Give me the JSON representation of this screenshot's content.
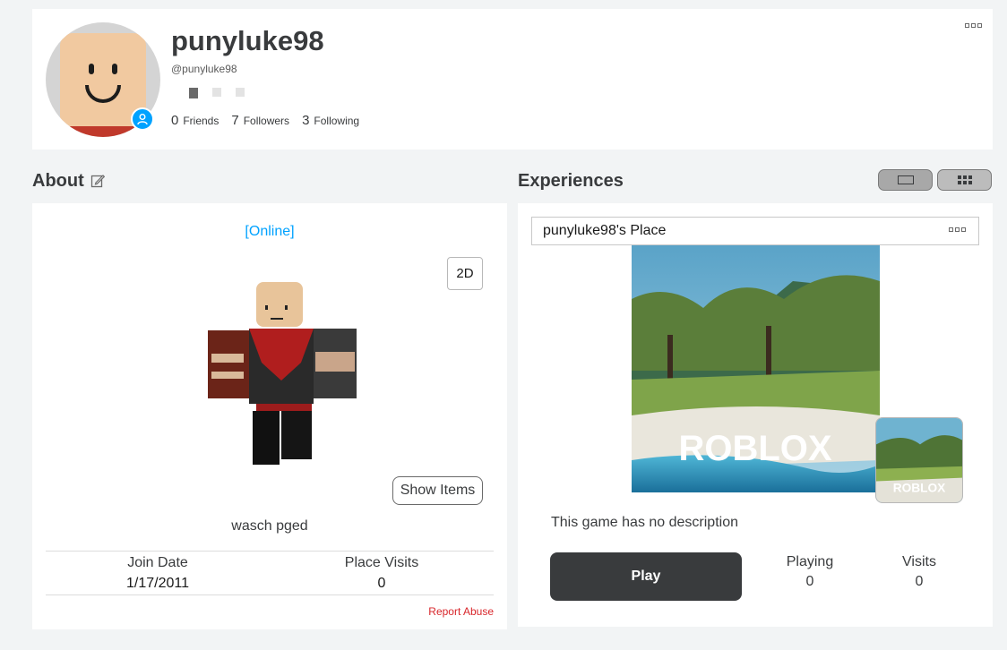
{
  "profile": {
    "display_name": "punyluke98",
    "username": "@punyluke98",
    "stats": [
      {
        "count": "0",
        "label": "Friends"
      },
      {
        "count": "7",
        "label": "Followers"
      },
      {
        "count": "3",
        "label": "Following"
      }
    ]
  },
  "about": {
    "title": "About",
    "status": "[Online]",
    "toggle_2d_label": "2D",
    "show_items_label": "Show Items",
    "blurb": "wasch pged",
    "join_date_label": "Join Date",
    "join_date": "1/17/2011",
    "place_visits_label": "Place Visits",
    "place_visits": "0",
    "report_abuse": "Report Abuse"
  },
  "experiences": {
    "title": "Experiences",
    "place_name": "punyluke98's Place",
    "description": "This game has no description",
    "play_label": "Play",
    "playing_label": "Playing",
    "playing_value": "0",
    "visits_label": "Visits",
    "visits_value": "0",
    "thumbnail_logo": "ROBLOX"
  },
  "colors": {
    "accent": "#00a2ff",
    "report": "#d8262b",
    "play_button": "#393b3d"
  }
}
